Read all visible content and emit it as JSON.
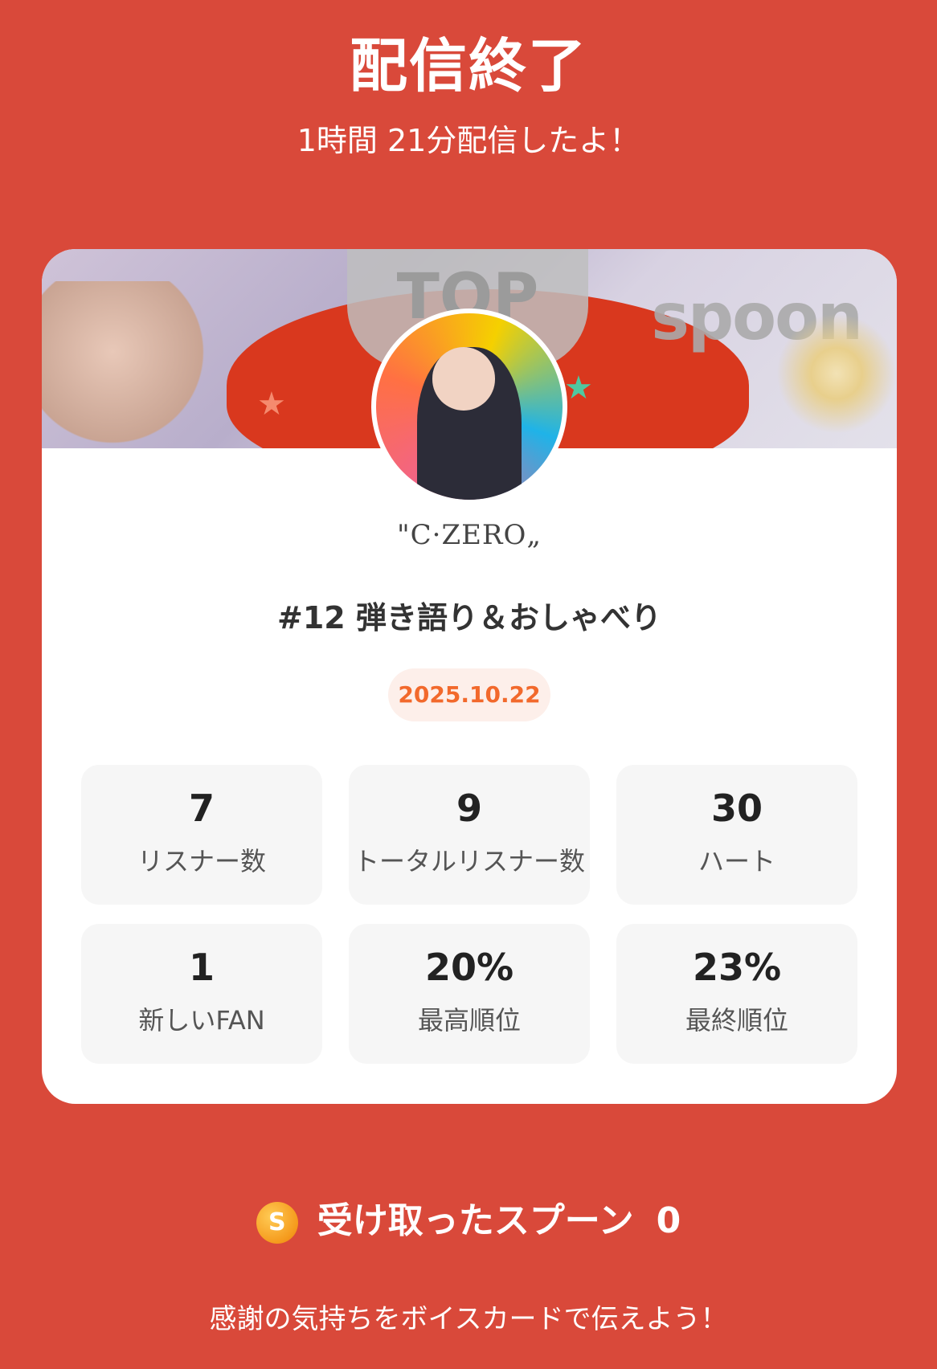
{
  "header": {
    "title": "配信終了",
    "subtitle": "1時間 21分配信したよ！"
  },
  "card": {
    "banner": {
      "trophy_text": "TOP",
      "logo_text": "spoon"
    },
    "username": "\"C·ZERO„",
    "broadcast_title": "#12  弾き語り＆おしゃべり",
    "date": "2025.10.22",
    "stats": [
      {
        "value": "7",
        "label": "リスナー数"
      },
      {
        "value": "9",
        "label": "トータルリスナー数"
      },
      {
        "value": "30",
        "label": "ハート"
      },
      {
        "value": "1",
        "label": "新しいFAN"
      },
      {
        "value": "20%",
        "label": "最高順位"
      },
      {
        "value": "23%",
        "label": "最終順位"
      }
    ]
  },
  "spoons": {
    "icon": "spoon-coin-icon",
    "icon_letter": "S",
    "label": "受け取ったスプーン",
    "count": "0"
  },
  "footer": {
    "message": "感謝の気持ちをボイスカードで伝えよう！"
  },
  "colors": {
    "background": "#D9493A",
    "card": "#FFFFFF",
    "date_text": "#F2692C",
    "date_bg": "#FDEFEA",
    "stat_bg": "#F6F6F6"
  }
}
